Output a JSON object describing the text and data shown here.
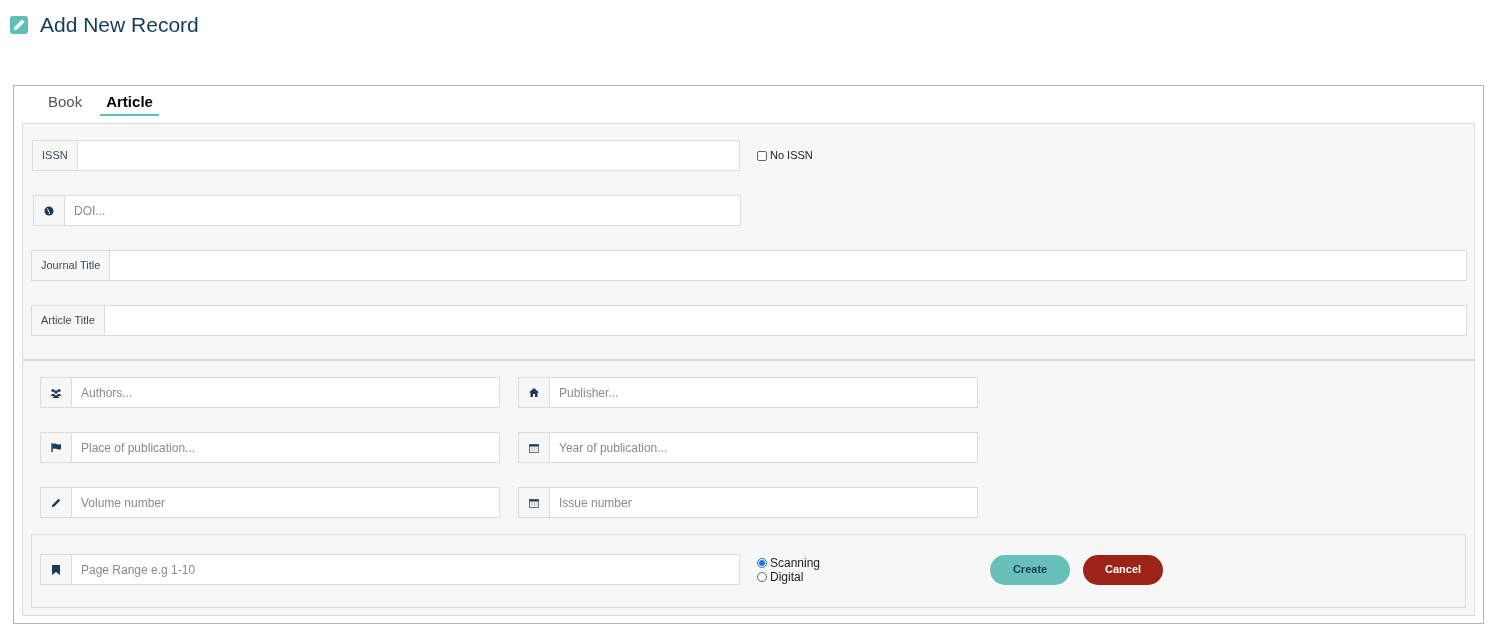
{
  "title": "Add New Record",
  "tabs": [
    {
      "label": "Book",
      "selected": false
    },
    {
      "label": "Article",
      "selected": true
    }
  ],
  "issn": {
    "label": "ISSN",
    "no_issn": {
      "label": "No ISSN",
      "checked": false
    }
  },
  "doi": {
    "placeholder": "DOI..."
  },
  "journal_title": {
    "label": "Journal Title"
  },
  "article_title": {
    "label": "Article Title"
  },
  "details": [
    {
      "placeholder": "Authors..."
    },
    {
      "placeholder": "Publisher..."
    },
    {
      "placeholder": "Place of publication..."
    },
    {
      "placeholder": "Year of publication..."
    },
    {
      "placeholder": "Volume number"
    },
    {
      "placeholder": "Issue number"
    }
  ],
  "page_range": {
    "placeholder": "Page Range e.g 1-10"
  },
  "format_options": [
    {
      "label": "Scanning",
      "selected": true
    },
    {
      "label": "Digital",
      "selected": false
    }
  ],
  "buttons": [
    {
      "label": "Create",
      "kind": "primary"
    },
    {
      "label": "Cancel",
      "kind": "danger"
    }
  ]
}
